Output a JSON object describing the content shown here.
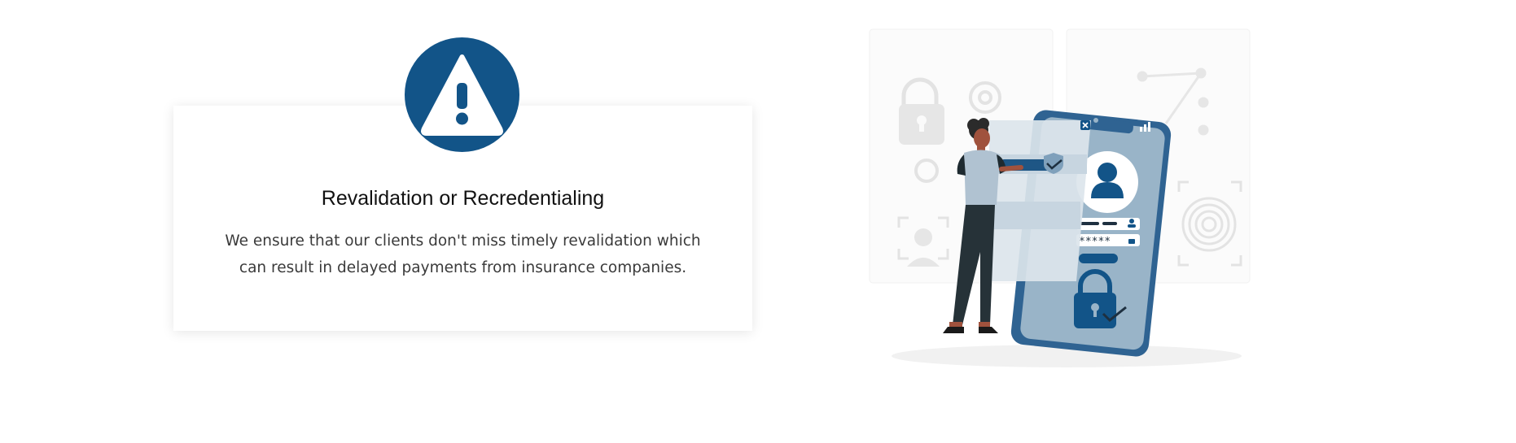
{
  "card": {
    "title": "Revalidation or Recredentialing",
    "description": "We ensure that our clients don't miss timely revalidation which can result in delayed payments from insurance companies.",
    "badge_icon": "warning-triangle-icon"
  },
  "illustration": {
    "icon": "security-login-illustration",
    "password_mask": "*****"
  },
  "colors": {
    "brand": "#125488",
    "light_blue": "#99b4c8",
    "text": "#3a3a3a"
  }
}
